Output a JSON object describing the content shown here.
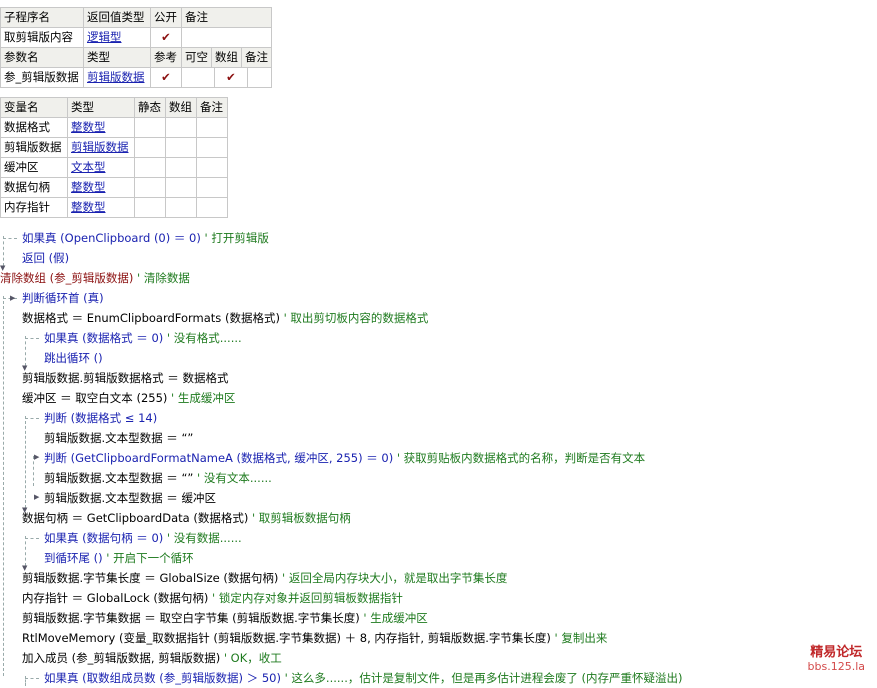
{
  "sub_header": {
    "cols": [
      "子程序名",
      "返回值类型",
      "公开",
      "备注"
    ],
    "row": {
      "name": "取剪辑版内容",
      "type": "逻辑型",
      "public": "✔",
      "note": ""
    }
  },
  "param_header": {
    "cols": [
      "参数名",
      "类型",
      "参考",
      "可空",
      "数组",
      "备注"
    ],
    "row": {
      "name": "参_剪辑版数据",
      "type": "剪辑版数据",
      "ref": "✔",
      "nullable": "",
      "array": "✔",
      "note": ""
    }
  },
  "var_table": {
    "cols": [
      "变量名",
      "类型",
      "静态",
      "数组",
      "备注"
    ],
    "rows": [
      {
        "name": "数据格式",
        "type": "整数型"
      },
      {
        "name": "剪辑版数据",
        "type": "剪辑版数据"
      },
      {
        "name": "缓冲区",
        "type": "文本型"
      },
      {
        "name": "数据句柄",
        "type": "整数型"
      },
      {
        "name": "内存指针",
        "type": "整数型"
      }
    ]
  },
  "code": [
    {
      "kw": "如果真",
      "rest": " (OpenClipboard (0) ＝ 0)",
      "cm": "' 打开剪辑版"
    },
    {
      "kw": "返回",
      "rest": " (假)",
      "cm": ""
    },
    {
      "kw": "清除数组",
      "rest": " (参_剪辑版数据)",
      "cm": "' 清除数据"
    },
    {
      "kw": "判断循环首",
      "rest": " (真)",
      "cm": ""
    },
    {
      "kw": "",
      "rest": "数据格式 ＝ EnumClipboardFormats (数据格式)",
      "cm": "' 取出剪切板内容的数据格式"
    },
    {
      "kw": "如果真",
      "rest": " (数据格式 ＝ 0)",
      "cm": "' 没有格式......"
    },
    {
      "kw": "跳出循环",
      "rest": " ()",
      "cm": ""
    },
    {
      "kw": "",
      "rest": "剪辑版数据.剪辑版数据格式 ＝ 数据格式",
      "cm": ""
    },
    {
      "kw": "",
      "rest": "缓冲区 ＝ 取空白文本 (255)",
      "cm": "' 生成缓冲区"
    },
    {
      "kw": "判断",
      "rest": " (数据格式 ≤ 14)",
      "cm": ""
    },
    {
      "kw": "",
      "rest": "剪辑版数据.文本型数据 ＝ “”",
      "cm": ""
    },
    {
      "kw": "判断",
      "rest": " (GetClipboardFormatNameA (数据格式, 缓冲区, 255) ＝ 0)",
      "cm": "' 获取剪贴板内数据格式的名称，判断是否有文本"
    },
    {
      "kw": "",
      "rest": "剪辑版数据.文本型数据 ＝ “”",
      "cm": "' 没有文本......"
    },
    {
      "kw": "",
      "rest": "剪辑版数据.文本型数据 ＝ 缓冲区",
      "cm": ""
    },
    {
      "kw": "",
      "rest": "数据句柄 ＝ GetClipboardData (数据格式)",
      "cm": "' 取剪辑板数据句柄"
    },
    {
      "kw": "如果真",
      "rest": " (数据句柄 ＝ 0)",
      "cm": "' 没有数据......"
    },
    {
      "kw": "到循环尾",
      "rest": " ()",
      "cm": "' 开启下一个循环"
    },
    {
      "kw": "",
      "rest": "剪辑版数据.字节集长度 ＝ GlobalSize (数据句柄)",
      "cm": "' 返回全局内存块大小，就是取出字节集长度"
    },
    {
      "kw": "",
      "rest": "内存指针 ＝ GlobalLock (数据句柄)",
      "cm": "' 锁定内存对象并返回剪辑板数据指针"
    },
    {
      "kw": "",
      "rest": "剪辑版数据.字节集数据 ＝ 取空白字节集 (剪辑版数据.字节集长度)",
      "cm": "' 生成缓冲区"
    },
    {
      "kw": "",
      "rest": "RtlMoveMemory (变量_取数据指针 (剪辑版数据.字节集数据) ＋ 8, 内存指针, 剪辑版数据.字节集长度)",
      "cm": "' 复制出来"
    },
    {
      "kw": "",
      "rest": "加入成员 (参_剪辑版数据, 剪辑版数据)",
      "cm": "' OK，收工"
    },
    {
      "kw": "如果真",
      "rest": " (取数组成员数 (参_剪辑版数据) ＞ 50)",
      "cm": "' 这么多......，估计是复制文件，但是再多估计进程会废了 (内存严重怀疑溢出)"
    }
  ],
  "watermark": {
    "title": "精易论坛",
    "url": "bbs.125.la"
  }
}
